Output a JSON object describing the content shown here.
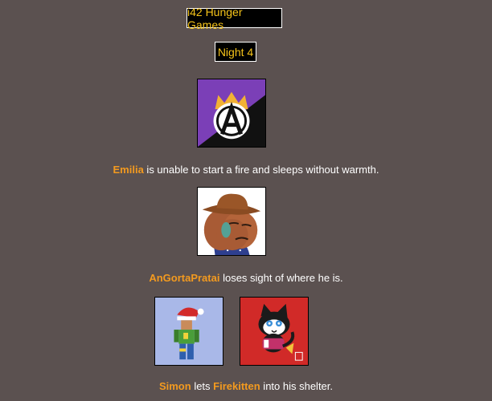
{
  "header": {
    "title": "i42 Hunger Games",
    "night": "Night 4"
  },
  "events": [
    {
      "tributes": [
        "Emilia"
      ],
      "text_1": " is unable to start a fire and sleeps without warmth."
    },
    {
      "tributes": [
        "AnGortaPratai"
      ],
      "text_1": " loses sight of where he is."
    },
    {
      "tributes": [
        "Simon",
        "Firekitten"
      ],
      "text_1": " lets ",
      "text_2": " into his shelter."
    }
  ],
  "avatars": {
    "emilia": "anarchy-crown-icon",
    "angortapratai": "cowboy-face-icon",
    "simon": "santa-hat-figure-icon",
    "firekitten": "cartoon-cat-icon"
  },
  "colors": {
    "background": "#5b5150",
    "title_text": "#f5c31a",
    "tribute_name": "#f39a1f",
    "body_text": "#ffffff"
  }
}
